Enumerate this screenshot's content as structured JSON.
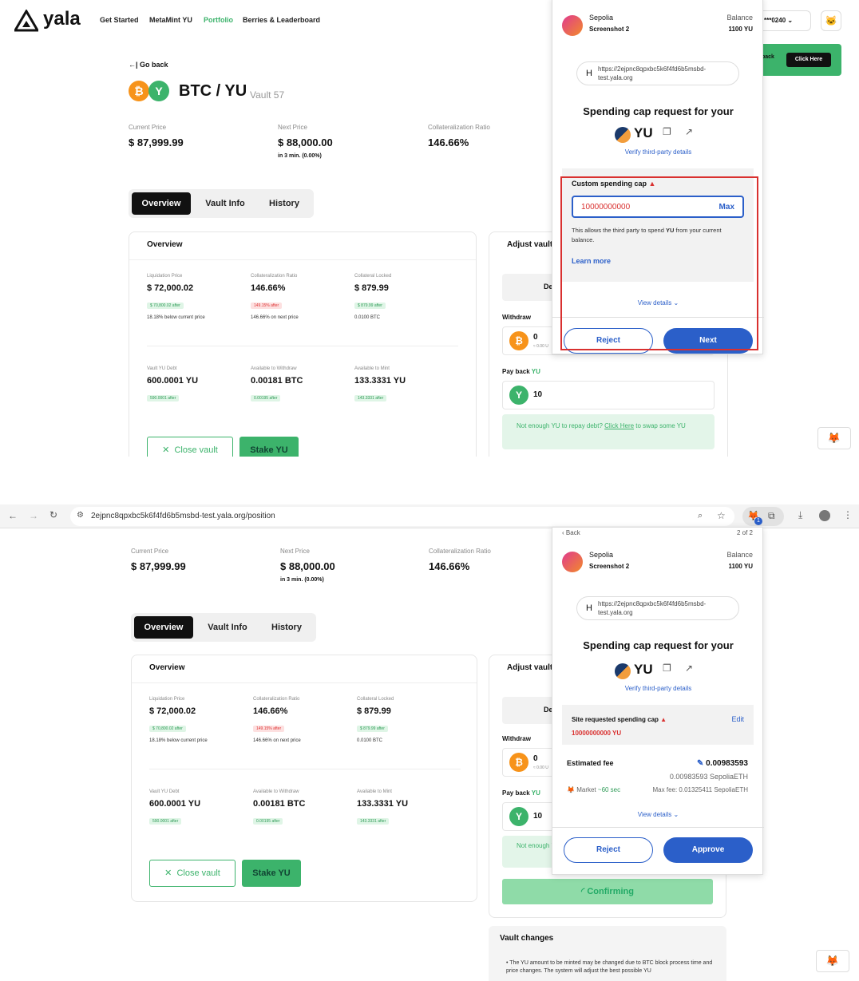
{
  "shot1": {
    "brand": "yala",
    "nav": [
      "Get Started",
      "MetaMint YU",
      "Portfolio",
      "Berries & Leaderboard"
    ],
    "account": "***0240",
    "go_back": "Go back",
    "pair": "BTC / YU",
    "vault": "Vault 57",
    "stats": {
      "current_price_label": "Current Price",
      "current_price": "$ 87,999.99",
      "next_price_label": "Next Price",
      "next_price": "$ 88,000.00",
      "next_price_sub": "in 3 min. (0.00%)",
      "coll_ratio_label": "Collateralization Ratio",
      "coll_ratio": "146.66%"
    },
    "tabs": [
      "Overview",
      "Vault Info",
      "History"
    ],
    "overview_title": "Overview",
    "adjust_title": "Adjust vault",
    "metrics": [
      {
        "label": "Liquidation Price",
        "value": "$ 72,000.02",
        "badge": "$ 70,800.02 after",
        "badge_type": "green",
        "sub": "18.18% below current price"
      },
      {
        "label": "Collateralization Ratio",
        "value": "146.66%",
        "badge": "149.15% after",
        "badge_type": "red",
        "sub": "146.66% on next price"
      },
      {
        "label": "Collateral Locked",
        "value": "$ 879.99",
        "badge": "$ 879.99 after",
        "badge_type": "green",
        "sub": "0.0100 BTC"
      },
      {
        "label": "Vault YU Debt",
        "value": "600.0001 YU",
        "badge": "590.0001 after",
        "badge_type": "green",
        "sub": ""
      },
      {
        "label": "Available to Withdraw",
        "value": "0.00181 BTC",
        "badge": "0.00195 after",
        "badge_type": "green",
        "sub": ""
      },
      {
        "label": "Available to Mint",
        "value": "133.3331 YU",
        "badge": "143.3331 after",
        "badge_type": "green",
        "sub": ""
      }
    ],
    "close_vault": "Close vault",
    "stake_yu": "Stake YU",
    "withdraw": "Withdraw",
    "withdraw_val": "0",
    "withdraw_sub": "≈ 0.00 U",
    "payback": "Pay back",
    "payback_unit": "YU",
    "payback_val": "10",
    "not_enough_pre": "Not enough YU to repay debt? ",
    "not_enough_link": "Click Here",
    "not_enough_post": " to swap some YU",
    "feedback_text": "back",
    "click_here": "Click Here",
    "deposit_short": "De",
    "mm": {
      "network": "Sepolia",
      "account": "Screenshot 2",
      "balance_label": "Balance",
      "balance": "1100 YU",
      "site": "https://2ejpnc8qpxbc5k6f4fd6b5msbd-test.yala.org",
      "site_letter": "H",
      "heading": "Spending cap request for your",
      "token": "YU",
      "verify": "Verify third-party details",
      "custom_cap_label": "Custom spending cap",
      "cap_value": "10000000000",
      "max": "Max",
      "allows_pre": "This allows the third party to spend ",
      "allows_bold": "YU",
      "allows_post": " from your current balance.",
      "learn_more": "Learn more",
      "view_details": "View details",
      "reject": "Reject",
      "next": "Next"
    }
  },
  "shot2": {
    "url": "2ejpnc8qpxbc5k6f4fd6b5msbd-test.yala.org/position",
    "stats": {
      "current_price_label": "Current Price",
      "current_price": "$ 87,999.99",
      "next_price_label": "Next Price",
      "next_price": "$ 88,000.00",
      "next_price_sub": "in 3 min. (0.00%)",
      "coll_ratio_label": "Collateralization Ratio",
      "coll_ratio": "146.66%"
    },
    "tabs": [
      "Overview",
      "Vault Info",
      "History"
    ],
    "overview_title": "Overview",
    "adjust_title": "Adjust vault",
    "metrics": [
      {
        "label": "Liquidation Price",
        "value": "$ 72,000.02",
        "badge": "$ 70,800.02 after",
        "badge_type": "green",
        "sub": "18.18% below current price"
      },
      {
        "label": "Collateralization Ratio",
        "value": "146.66%",
        "badge": "149.15% after",
        "badge_type": "red",
        "sub": "146.66% on next price"
      },
      {
        "label": "Collateral Locked",
        "value": "$ 879.99",
        "badge": "$ 879.99 after",
        "badge_type": "green",
        "sub": "0.0100 BTC"
      },
      {
        "label": "Vault YU Debt",
        "value": "600.0001 YU",
        "badge": "590.0001 after",
        "badge_type": "green",
        "sub": ""
      },
      {
        "label": "Available to Withdraw",
        "value": "0.00181 BTC",
        "badge": "0.00195 after",
        "badge_type": "green",
        "sub": ""
      },
      {
        "label": "Available to Mint",
        "value": "133.3331 YU",
        "badge": "143.3331 after",
        "badge_type": "green",
        "sub": ""
      }
    ],
    "close_vault": "Close vault",
    "stake_yu": "Stake YU",
    "withdraw": "Withdraw",
    "withdraw_val": "0",
    "withdraw_sub": "≈ 0.00 U",
    "payback": "Pay back",
    "payback_unit": "YU",
    "payback_val": "10",
    "not_enough": "Not enough YU",
    "confirming": "Confirming",
    "vault_changes": "Vault changes",
    "vault_changes_note": "The YU amount to be minted may be changed due to BTC block process time and price changes. The system will adjust the best possible YU",
    "deposit_short": "De",
    "extension_badge": "1",
    "mm": {
      "back": "Back",
      "page": "2 of 2",
      "network": "Sepolia",
      "account": "Screenshot 2",
      "balance_label": "Balance",
      "balance": "1100 YU",
      "site": "https://2ejpnc8qpxbc5k6f4fd6b5msbd-test.yala.org",
      "site_letter": "H",
      "heading": "Spending cap request for your",
      "token": "YU",
      "verify": "Verify third-party details",
      "site_cap_label": "Site requested spending cap",
      "edit": "Edit",
      "cap_value": "10000000000 YU",
      "est_fee_label": "Estimated fee",
      "est_fee": "0.00983593",
      "fee_eth": "0.00983593 SepoliaETH",
      "market": "Market",
      "market_time": "~60 sec",
      "max_fee": "Max fee: 0.01325411 SepoliaETH",
      "view_details": "View details",
      "reject": "Reject",
      "approve": "Approve"
    }
  },
  "colors": {
    "green": "#3cb36b",
    "blue": "#2b5fc9",
    "red": "#d9302f",
    "btc": "#f7931a"
  }
}
